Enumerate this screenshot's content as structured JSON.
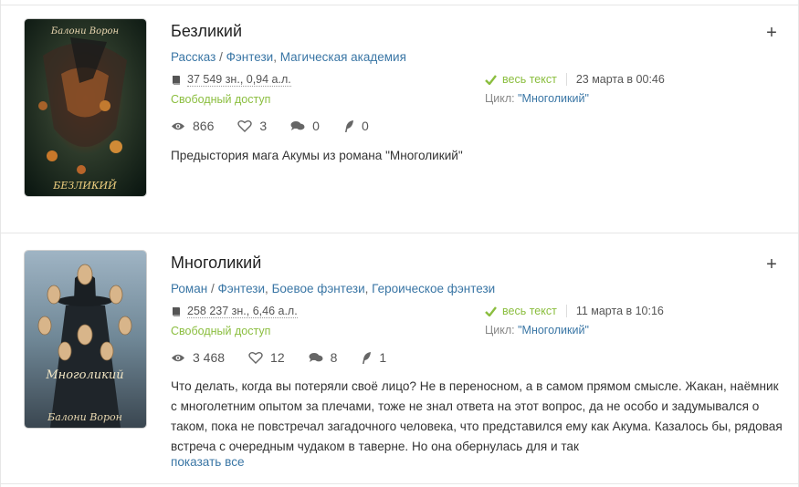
{
  "books": [
    {
      "title": "Безликий",
      "type": "Рассказ",
      "genres": [
        "Фэнтези",
        "Магическая академия"
      ],
      "size": "37 549 зн., 0,94 а.л.",
      "access": "Свободный доступ",
      "status": "весь текст",
      "date": "23 марта в 00:46",
      "cycle_label": "Цикл:",
      "cycle_name": "\"Многоликий\"",
      "views": "866",
      "likes": "3",
      "comments": "0",
      "rewards": "0",
      "description": "Предыстория мага Акумы из романа \"Многоликий\"",
      "cover_top_text": "Балони Ворон",
      "cover_bottom_text": "БЕЗЛИКИЙ"
    },
    {
      "title": "Многоликий",
      "type": "Роман",
      "genres": [
        "Фэнтези",
        "Боевое фэнтези",
        "Героическое фэнтези"
      ],
      "size": "258 237 зн., 6,46 а.л.",
      "access": "Свободный доступ",
      "status": "весь текст",
      "date": "11 марта в 10:16",
      "cycle_label": "Цикл:",
      "cycle_name": "\"Многоликий\"",
      "views": "3 468",
      "likes": "12",
      "comments": "8",
      "rewards": "1",
      "description": "Что делать, когда вы потеряли своё лицо? Не в переносном, а в самом прямом смысле. Жакан, наёмник с многолетним опытом за плечами, тоже не знал ответа на этот вопрос, да не особо и задумывался о таком, пока не повстречал загадочного человека, что представился ему как Акума. Казалось бы, рядовая встреча с очередным чудаком в таверне. Но она обернулась для и так",
      "show_all": "показать все",
      "cover_top_text": "",
      "cover_mid_text": "Многоликий",
      "cover_bottom_text": "Балони Ворон"
    }
  ],
  "colors": {
    "link": "#3a76a5",
    "green": "#8bbe3f",
    "divider": "#e6e6e6"
  },
  "icons": {
    "plus": "+",
    "book": "book-icon",
    "check": "check-icon",
    "eye": "eye-icon",
    "heart": "heart-icon",
    "comments": "comments-icon",
    "reward": "feather-icon"
  }
}
